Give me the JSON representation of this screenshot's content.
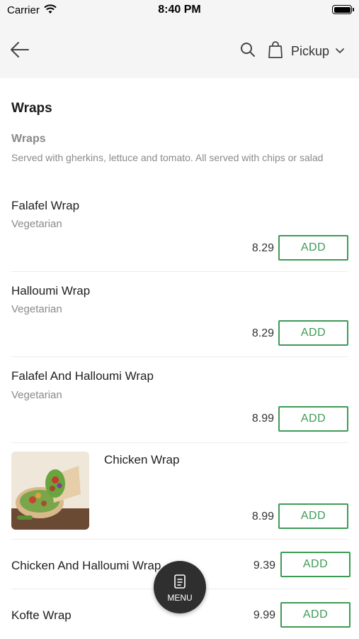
{
  "status_bar": {
    "carrier": "Carrier",
    "time": "8:40 PM"
  },
  "header": {
    "pickup_label": "Pickup"
  },
  "section": {
    "title": "Wraps",
    "subtitle": "Wraps",
    "description": "Served with gherkins, lettuce and tomato. All served with chips or salad"
  },
  "add_label": "ADD",
  "items": [
    {
      "name": "Falafel Wrap",
      "tag": "Vegetarian",
      "price": "8.29"
    },
    {
      "name": "Halloumi Wrap",
      "tag": "Vegetarian",
      "price": "8.29"
    },
    {
      "name": "Falafel And Halloumi Wrap",
      "tag": "Vegetarian",
      "price": "8.99"
    },
    {
      "name": "Chicken Wrap",
      "price": "8.99"
    },
    {
      "name": "Chicken And Halloumi Wrap",
      "price": "9.39"
    },
    {
      "name": "Kofte Wrap",
      "price": "9.99"
    }
  ],
  "menu_fab": {
    "label": "MENU"
  },
  "colors": {
    "accent": "#3d9b55",
    "header_bg": "#f5f5f5",
    "fab_bg": "#2f2f2f"
  }
}
